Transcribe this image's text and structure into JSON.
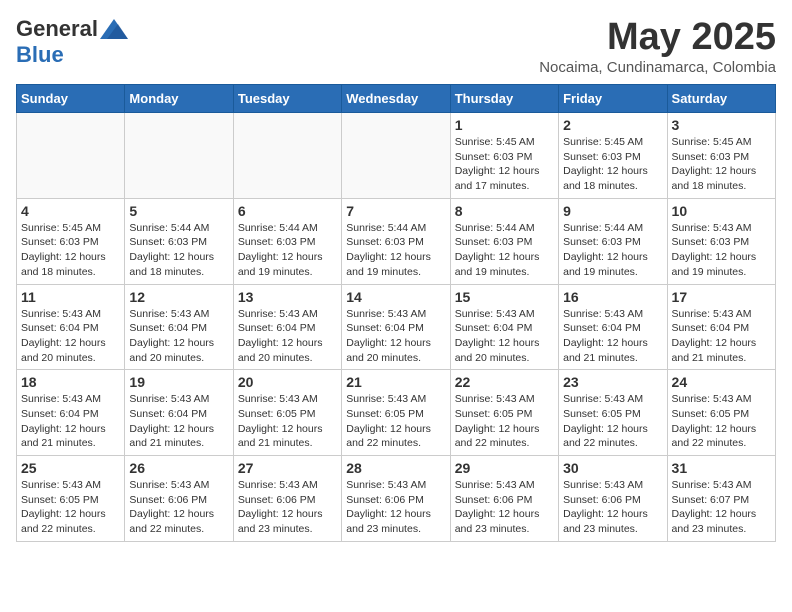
{
  "logo": {
    "general": "General",
    "blue": "Blue"
  },
  "title": "May 2025",
  "subtitle": "Nocaima, Cundinamarca, Colombia",
  "weekdays": [
    "Sunday",
    "Monday",
    "Tuesday",
    "Wednesday",
    "Thursday",
    "Friday",
    "Saturday"
  ],
  "weeks": [
    [
      {
        "day": "",
        "info": ""
      },
      {
        "day": "",
        "info": ""
      },
      {
        "day": "",
        "info": ""
      },
      {
        "day": "",
        "info": ""
      },
      {
        "day": "1",
        "info": "Sunrise: 5:45 AM\nSunset: 6:03 PM\nDaylight: 12 hours\nand 17 minutes."
      },
      {
        "day": "2",
        "info": "Sunrise: 5:45 AM\nSunset: 6:03 PM\nDaylight: 12 hours\nand 18 minutes."
      },
      {
        "day": "3",
        "info": "Sunrise: 5:45 AM\nSunset: 6:03 PM\nDaylight: 12 hours\nand 18 minutes."
      }
    ],
    [
      {
        "day": "4",
        "info": "Sunrise: 5:45 AM\nSunset: 6:03 PM\nDaylight: 12 hours\nand 18 minutes."
      },
      {
        "day": "5",
        "info": "Sunrise: 5:44 AM\nSunset: 6:03 PM\nDaylight: 12 hours\nand 18 minutes."
      },
      {
        "day": "6",
        "info": "Sunrise: 5:44 AM\nSunset: 6:03 PM\nDaylight: 12 hours\nand 19 minutes."
      },
      {
        "day": "7",
        "info": "Sunrise: 5:44 AM\nSunset: 6:03 PM\nDaylight: 12 hours\nand 19 minutes."
      },
      {
        "day": "8",
        "info": "Sunrise: 5:44 AM\nSunset: 6:03 PM\nDaylight: 12 hours\nand 19 minutes."
      },
      {
        "day": "9",
        "info": "Sunrise: 5:44 AM\nSunset: 6:03 PM\nDaylight: 12 hours\nand 19 minutes."
      },
      {
        "day": "10",
        "info": "Sunrise: 5:43 AM\nSunset: 6:03 PM\nDaylight: 12 hours\nand 19 minutes."
      }
    ],
    [
      {
        "day": "11",
        "info": "Sunrise: 5:43 AM\nSunset: 6:04 PM\nDaylight: 12 hours\nand 20 minutes."
      },
      {
        "day": "12",
        "info": "Sunrise: 5:43 AM\nSunset: 6:04 PM\nDaylight: 12 hours\nand 20 minutes."
      },
      {
        "day": "13",
        "info": "Sunrise: 5:43 AM\nSunset: 6:04 PM\nDaylight: 12 hours\nand 20 minutes."
      },
      {
        "day": "14",
        "info": "Sunrise: 5:43 AM\nSunset: 6:04 PM\nDaylight: 12 hours\nand 20 minutes."
      },
      {
        "day": "15",
        "info": "Sunrise: 5:43 AM\nSunset: 6:04 PM\nDaylight: 12 hours\nand 20 minutes."
      },
      {
        "day": "16",
        "info": "Sunrise: 5:43 AM\nSunset: 6:04 PM\nDaylight: 12 hours\nand 21 minutes."
      },
      {
        "day": "17",
        "info": "Sunrise: 5:43 AM\nSunset: 6:04 PM\nDaylight: 12 hours\nand 21 minutes."
      }
    ],
    [
      {
        "day": "18",
        "info": "Sunrise: 5:43 AM\nSunset: 6:04 PM\nDaylight: 12 hours\nand 21 minutes."
      },
      {
        "day": "19",
        "info": "Sunrise: 5:43 AM\nSunset: 6:04 PM\nDaylight: 12 hours\nand 21 minutes."
      },
      {
        "day": "20",
        "info": "Sunrise: 5:43 AM\nSunset: 6:05 PM\nDaylight: 12 hours\nand 21 minutes."
      },
      {
        "day": "21",
        "info": "Sunrise: 5:43 AM\nSunset: 6:05 PM\nDaylight: 12 hours\nand 22 minutes."
      },
      {
        "day": "22",
        "info": "Sunrise: 5:43 AM\nSunset: 6:05 PM\nDaylight: 12 hours\nand 22 minutes."
      },
      {
        "day": "23",
        "info": "Sunrise: 5:43 AM\nSunset: 6:05 PM\nDaylight: 12 hours\nand 22 minutes."
      },
      {
        "day": "24",
        "info": "Sunrise: 5:43 AM\nSunset: 6:05 PM\nDaylight: 12 hours\nand 22 minutes."
      }
    ],
    [
      {
        "day": "25",
        "info": "Sunrise: 5:43 AM\nSunset: 6:05 PM\nDaylight: 12 hours\nand 22 minutes."
      },
      {
        "day": "26",
        "info": "Sunrise: 5:43 AM\nSunset: 6:06 PM\nDaylight: 12 hours\nand 22 minutes."
      },
      {
        "day": "27",
        "info": "Sunrise: 5:43 AM\nSunset: 6:06 PM\nDaylight: 12 hours\nand 23 minutes."
      },
      {
        "day": "28",
        "info": "Sunrise: 5:43 AM\nSunset: 6:06 PM\nDaylight: 12 hours\nand 23 minutes."
      },
      {
        "day": "29",
        "info": "Sunrise: 5:43 AM\nSunset: 6:06 PM\nDaylight: 12 hours\nand 23 minutes."
      },
      {
        "day": "30",
        "info": "Sunrise: 5:43 AM\nSunset: 6:06 PM\nDaylight: 12 hours\nand 23 minutes."
      },
      {
        "day": "31",
        "info": "Sunrise: 5:43 AM\nSunset: 6:07 PM\nDaylight: 12 hours\nand 23 minutes."
      }
    ]
  ]
}
